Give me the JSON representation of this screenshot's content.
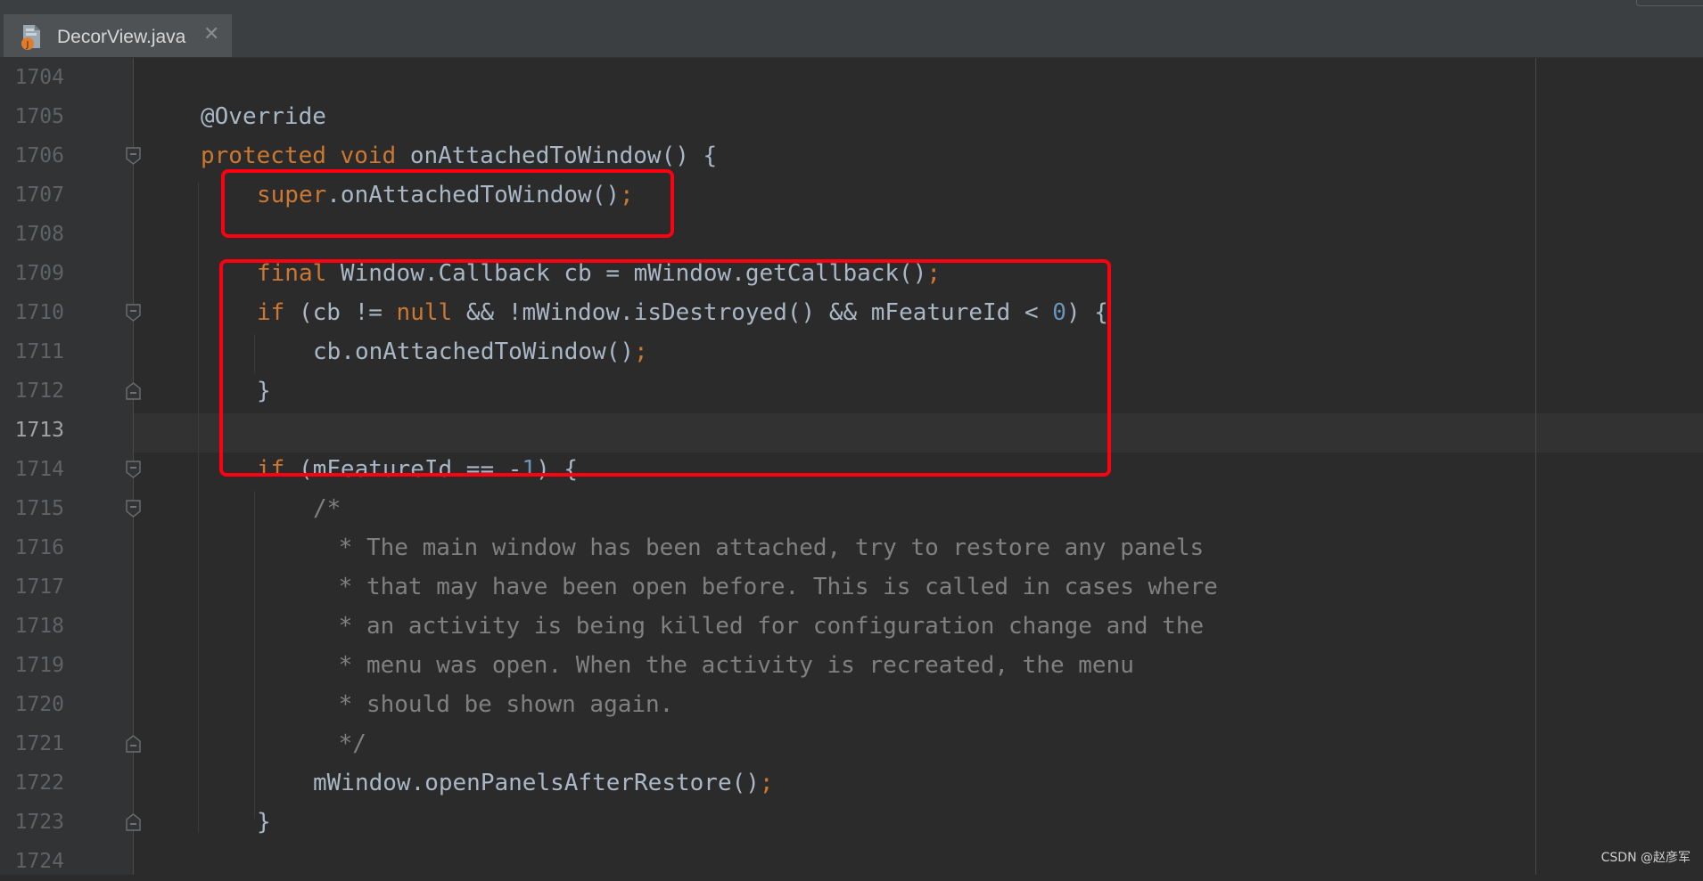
{
  "tab": {
    "filename": "DecorView.java",
    "close_glyph": "✕",
    "icon": "java-file-icon"
  },
  "editor": {
    "current_line": 1713,
    "lines": [
      {
        "num": "1704",
        "tokens": []
      },
      {
        "num": "1705",
        "tokens": [
          {
            "t": "@Override",
            "c": "default"
          }
        ]
      },
      {
        "num": "1706",
        "tokens": [
          {
            "t": "protected ",
            "c": "kw"
          },
          {
            "t": "void ",
            "c": "kw"
          },
          {
            "t": "onAttachedToWindow",
            "c": "default"
          },
          {
            "t": "() {",
            "c": "default"
          }
        ]
      },
      {
        "num": "1707",
        "tokens": [
          {
            "t": "super",
            "c": "kw"
          },
          {
            "t": ".onAttachedToWindow()",
            "c": "default"
          },
          {
            "t": ";",
            "c": "kw"
          }
        ]
      },
      {
        "num": "1708",
        "tokens": []
      },
      {
        "num": "1709",
        "tokens": [
          {
            "t": "final ",
            "c": "kw"
          },
          {
            "t": "Window.Callback cb = mWindow.getCallback()",
            "c": "default"
          },
          {
            "t": ";",
            "c": "kw"
          }
        ]
      },
      {
        "num": "1710",
        "tokens": [
          {
            "t": "if ",
            "c": "kw"
          },
          {
            "t": "(cb != ",
            "c": "default"
          },
          {
            "t": "null ",
            "c": "kw"
          },
          {
            "t": "&& !mWindow.isDestroyed() && mFeatureId < ",
            "c": "default"
          },
          {
            "t": "0",
            "c": "num"
          },
          {
            "t": ") {",
            "c": "default"
          }
        ]
      },
      {
        "num": "1711",
        "tokens": [
          {
            "t": "cb.onAttachedToWindow()",
            "c": "default"
          },
          {
            "t": ";",
            "c": "kw"
          }
        ]
      },
      {
        "num": "1712",
        "tokens": [
          {
            "t": "}",
            "c": "default"
          }
        ]
      },
      {
        "num": "1713",
        "tokens": []
      },
      {
        "num": "1714",
        "tokens": [
          {
            "t": "if ",
            "c": "kw"
          },
          {
            "t": "(mFeatureId == -",
            "c": "default"
          },
          {
            "t": "1",
            "c": "num"
          },
          {
            "t": ") {",
            "c": "default"
          }
        ]
      },
      {
        "num": "1715",
        "tokens": [
          {
            "t": "/*",
            "c": "cm"
          }
        ]
      },
      {
        "num": "1716",
        "tokens": [
          {
            "t": " * The main window has been attached, try to restore any panels",
            "c": "cm"
          }
        ]
      },
      {
        "num": "1717",
        "tokens": [
          {
            "t": " * that may have been open before. This is called in cases where",
            "c": "cm"
          }
        ]
      },
      {
        "num": "1718",
        "tokens": [
          {
            "t": " * an activity is being killed for configuration change and the",
            "c": "cm"
          }
        ]
      },
      {
        "num": "1719",
        "tokens": [
          {
            "t": " * menu was open. When the activity is recreated, the menu",
            "c": "cm"
          }
        ]
      },
      {
        "num": "1720",
        "tokens": [
          {
            "t": " * should be shown again.",
            "c": "cm"
          }
        ]
      },
      {
        "num": "1721",
        "tokens": [
          {
            "t": " */",
            "c": "cm"
          }
        ]
      },
      {
        "num": "1722",
        "tokens": [
          {
            "t": "mWindow.openPanelsAfterRestore()",
            "c": "default"
          },
          {
            "t": ";",
            "c": "kw"
          }
        ]
      },
      {
        "num": "1723",
        "tokens": [
          {
            "t": "}",
            "c": "default"
          }
        ]
      },
      {
        "num": "1724",
        "tokens": []
      }
    ]
  },
  "watermark": "CSDN @赵彦军",
  "colors": {
    "background": "#2b2b2b",
    "gutter": "#313335",
    "keyword": "#cc7832",
    "number": "#6897bb",
    "comment": "#808080",
    "text": "#a9b7c6",
    "highlight_box": "#ff0011",
    "tab_accent": "#4a88c7"
  }
}
